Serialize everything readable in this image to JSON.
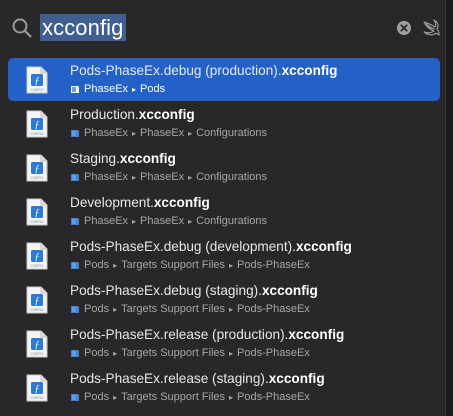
{
  "search": {
    "query": "xcconfig"
  },
  "results": [
    {
      "name": "Pods-PhaseEx.debug (production).",
      "ext": "xcconfig",
      "path": [
        "PhaseEx",
        "Pods"
      ],
      "selected": true
    },
    {
      "name": "Production.",
      "ext": "xcconfig",
      "path": [
        "PhaseEx",
        "PhaseEx",
        "Configurations"
      ]
    },
    {
      "name": "Staging.",
      "ext": "xcconfig",
      "path": [
        "PhaseEx",
        "PhaseEx",
        "Configurations"
      ]
    },
    {
      "name": "Development.",
      "ext": "xcconfig",
      "path": [
        "PhaseEx",
        "PhaseEx",
        "Configurations"
      ]
    },
    {
      "name": "Pods-PhaseEx.debug (development).",
      "ext": "xcconfig",
      "path": [
        "Pods",
        "Targets Support Files",
        "Pods-PhaseEx"
      ]
    },
    {
      "name": "Pods-PhaseEx.debug (staging).",
      "ext": "xcconfig",
      "path": [
        "Pods",
        "Targets Support Files",
        "Pods-PhaseEx"
      ]
    },
    {
      "name": "Pods-PhaseEx.release (production).",
      "ext": "xcconfig",
      "path": [
        "Pods",
        "Targets Support Files",
        "Pods-PhaseEx"
      ]
    },
    {
      "name": "Pods-PhaseEx.release (staging).",
      "ext": "xcconfig",
      "path": [
        "Pods",
        "Targets Support Files",
        "Pods-PhaseEx"
      ]
    }
  ],
  "icons": {
    "search": "magnifying-glass-icon",
    "clear": "clear-circle-icon",
    "swift": "swift-bird-icon",
    "file": "xcconfig-file-icon",
    "folder": "blue-folder-icon",
    "separator": "▸"
  },
  "colors": {
    "selection": "#2461c6",
    "query_highlight": "#3e5f8f",
    "panel": "#28282a"
  }
}
